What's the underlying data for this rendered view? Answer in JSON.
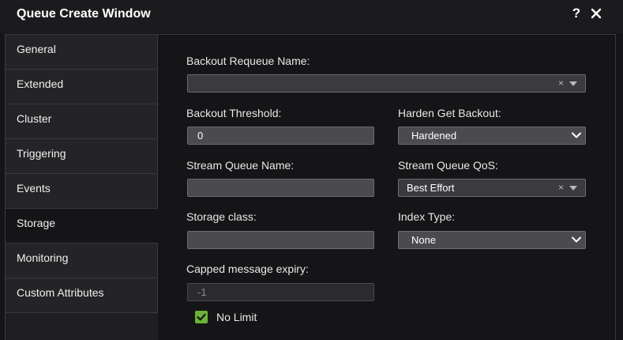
{
  "window": {
    "title": "Queue Create Window",
    "help_label": "?",
    "close_icon": "close-icon"
  },
  "sidebar": {
    "items": [
      {
        "label": "General"
      },
      {
        "label": "Extended"
      },
      {
        "label": "Cluster"
      },
      {
        "label": "Triggering"
      },
      {
        "label": "Events"
      },
      {
        "label": "Storage",
        "active": true
      },
      {
        "label": "Monitoring"
      },
      {
        "label": "Custom Attributes"
      }
    ]
  },
  "form": {
    "backout_requeue_name": {
      "label": "Backout Requeue Name:",
      "value": ""
    },
    "backout_threshold": {
      "label": "Backout Threshold:",
      "value": "0"
    },
    "harden_get_backout": {
      "label": "Harden Get Backout:",
      "value": "Hardened"
    },
    "stream_queue_name": {
      "label": "Stream Queue Name:",
      "value": ""
    },
    "stream_queue_qos": {
      "label": "Stream Queue QoS:",
      "value": "Best Effort"
    },
    "storage_class": {
      "label": "Storage class:",
      "value": ""
    },
    "index_type": {
      "label": "Index Type:",
      "value": "None"
    },
    "capped_message_expiry": {
      "label": "Capped message expiry:",
      "value": "-1"
    },
    "no_limit": {
      "label": "No Limit",
      "checked": true
    }
  },
  "glyphs": {
    "clear": "×"
  },
  "colors": {
    "background": "#151517",
    "checkbox_accent": "#6bb23a"
  }
}
